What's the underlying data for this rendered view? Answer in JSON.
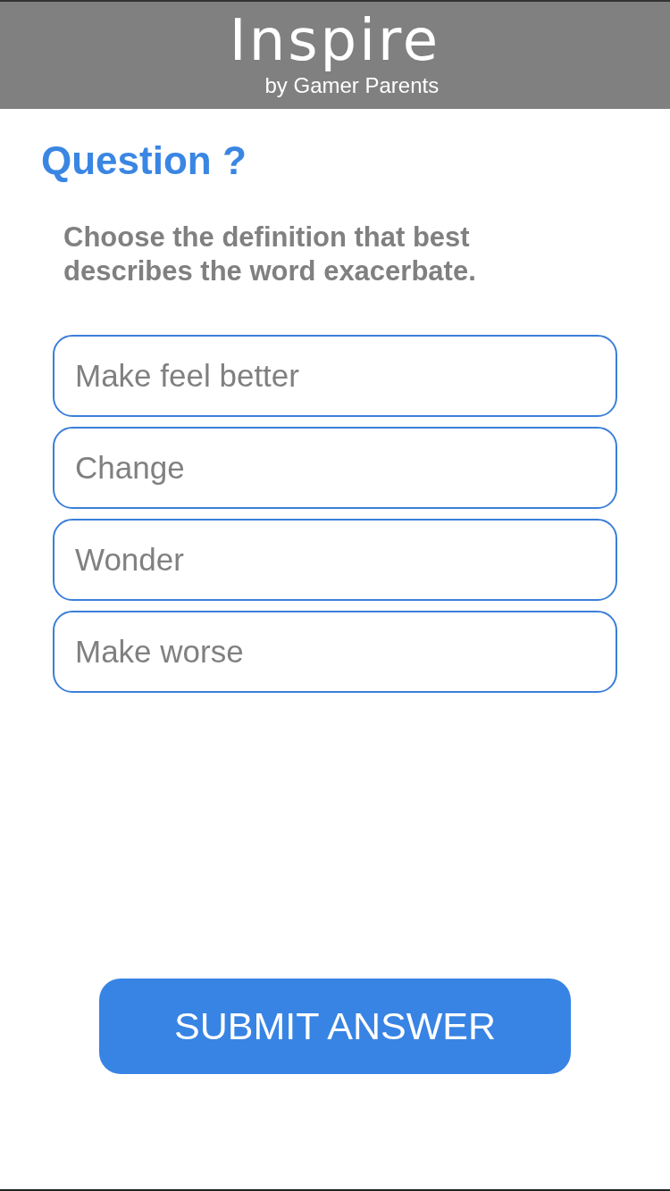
{
  "header": {
    "logo": "Inspire",
    "tagline": "by Gamer Parents"
  },
  "question": {
    "title": "Question ?",
    "prompt": "Choose the definition that best describes the word exacerbate."
  },
  "options": [
    {
      "label": "Make feel better",
      "selected": false
    },
    {
      "label": "Change",
      "selected": false
    },
    {
      "label": "Wonder",
      "selected": false
    },
    {
      "label": "Make worse",
      "selected": false
    }
  ],
  "submit_button": {
    "label": "SUBMIT ANSWER"
  }
}
